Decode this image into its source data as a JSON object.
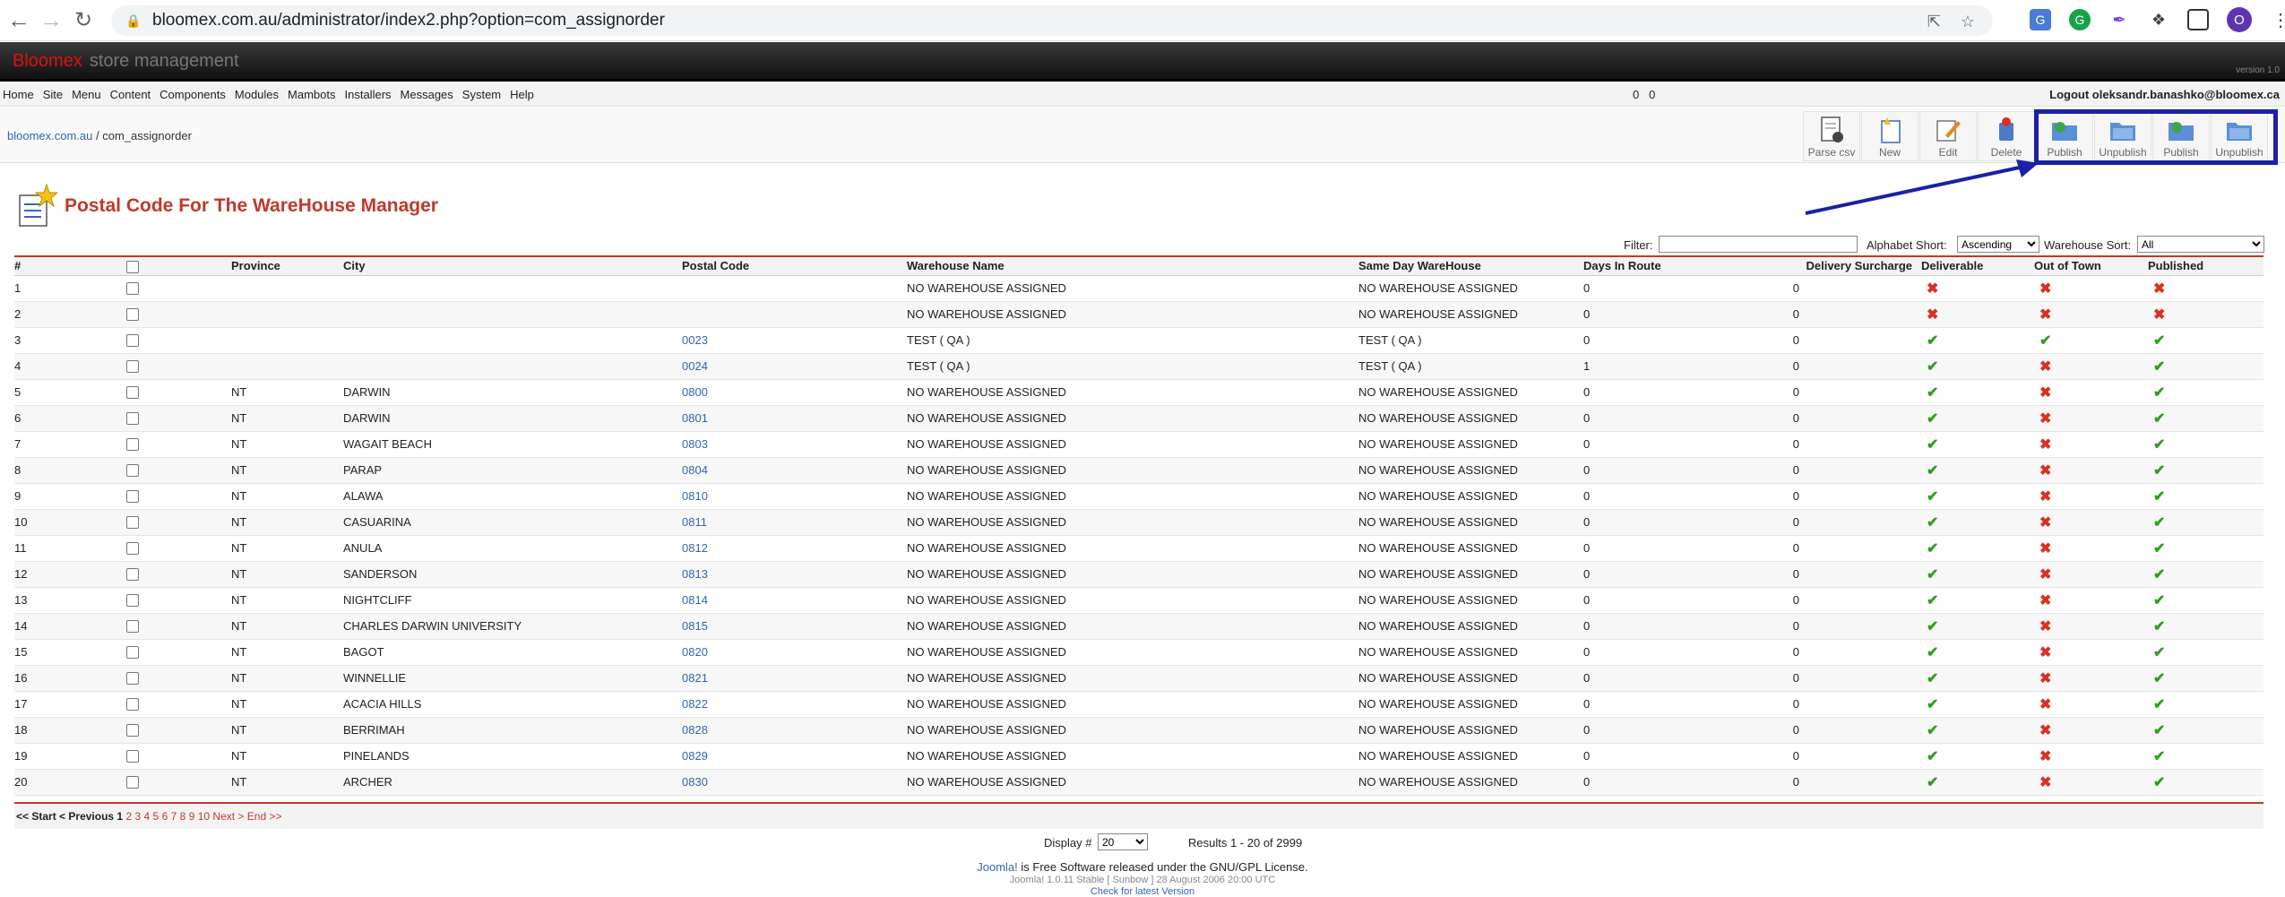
{
  "browser": {
    "url": "bloomex.com.au/administrator/index2.php?option=com_assignorder",
    "profile_initial": "O"
  },
  "header": {
    "brand": "Bloomex",
    "subtitle": "store management",
    "version": "version 1.0"
  },
  "menu": {
    "items": [
      "Home",
      "Site",
      "Menu",
      "Content",
      "Components",
      "Modules",
      "Mambots",
      "Installers",
      "Messages",
      "System",
      "Help"
    ],
    "counter_a": "0",
    "counter_b": "0",
    "logout": "Logout oleksandr.banashko@bloomex.ca"
  },
  "pathway": {
    "site": "bloomex.com.au",
    "separator": " / ",
    "component": "com_assignorder"
  },
  "toolbar": {
    "buttons": [
      {
        "label": "Parse csv"
      },
      {
        "label": "New"
      },
      {
        "label": "Edit"
      },
      {
        "label": "Delete"
      },
      {
        "label": "Publish"
      },
      {
        "label": "Unpublish"
      },
      {
        "label": "Publish"
      },
      {
        "label": "Unpublish"
      }
    ]
  },
  "page": {
    "title": "Postal Code For The WareHouse Manager"
  },
  "filter": {
    "label": "Filter:",
    "value": "",
    "sort_label": "Alphabet Short:",
    "sort_value": "Ascending",
    "warehouse_label": "Warehouse Sort:",
    "warehouse_value": "All"
  },
  "table": {
    "headers": {
      "num": "#",
      "province": "Province",
      "city": "City",
      "postal": "Postal Code",
      "warehouse": "Warehouse Name",
      "sameday": "Same Day WareHouse",
      "days": "Days In Route",
      "surcharge": "Delivery Surcharge",
      "deliverable": "Deliverable",
      "outoftown": "Out of Town",
      "published": "Published"
    },
    "rows": [
      {
        "num": "1",
        "province": "",
        "city": "",
        "postal": "",
        "warehouse": "NO WAREHOUSE ASSIGNED",
        "sameday": "NO WAREHOUSE ASSIGNED",
        "days": "0",
        "surcharge": "0",
        "deliverable": "no",
        "outoftown": "no",
        "published": "no"
      },
      {
        "num": "2",
        "province": "",
        "city": "",
        "postal": "",
        "warehouse": "NO WAREHOUSE ASSIGNED",
        "sameday": "NO WAREHOUSE ASSIGNED",
        "days": "0",
        "surcharge": "0",
        "deliverable": "no",
        "outoftown": "no",
        "published": "no"
      },
      {
        "num": "3",
        "province": "",
        "city": "",
        "postal": "0023",
        "warehouse": "TEST ( QA )",
        "sameday": "TEST ( QA )",
        "days": "0",
        "surcharge": "0",
        "deliverable": "yes",
        "outoftown": "yes",
        "published": "yes"
      },
      {
        "num": "4",
        "province": "",
        "city": "",
        "postal": "0024",
        "warehouse": "TEST ( QA )",
        "sameday": "TEST ( QA )",
        "days": "1",
        "surcharge": "0",
        "deliverable": "yes",
        "outoftown": "no",
        "published": "yes"
      },
      {
        "num": "5",
        "province": "NT",
        "city": "DARWIN",
        "postal": "0800",
        "warehouse": "NO WAREHOUSE ASSIGNED",
        "sameday": "NO WAREHOUSE ASSIGNED",
        "days": "0",
        "surcharge": "0",
        "deliverable": "yes",
        "outoftown": "no",
        "published": "yes"
      },
      {
        "num": "6",
        "province": "NT",
        "city": "DARWIN",
        "postal": "0801",
        "warehouse": "NO WAREHOUSE ASSIGNED",
        "sameday": "NO WAREHOUSE ASSIGNED",
        "days": "0",
        "surcharge": "0",
        "deliverable": "yes",
        "outoftown": "no",
        "published": "yes"
      },
      {
        "num": "7",
        "province": "NT",
        "city": "WAGAIT BEACH",
        "postal": "0803",
        "warehouse": "NO WAREHOUSE ASSIGNED",
        "sameday": "NO WAREHOUSE ASSIGNED",
        "days": "0",
        "surcharge": "0",
        "deliverable": "yes",
        "outoftown": "no",
        "published": "yes"
      },
      {
        "num": "8",
        "province": "NT",
        "city": "PARAP",
        "postal": "0804",
        "warehouse": "NO WAREHOUSE ASSIGNED",
        "sameday": "NO WAREHOUSE ASSIGNED",
        "days": "0",
        "surcharge": "0",
        "deliverable": "yes",
        "outoftown": "no",
        "published": "yes"
      },
      {
        "num": "9",
        "province": "NT",
        "city": "ALAWA",
        "postal": "0810",
        "warehouse": "NO WAREHOUSE ASSIGNED",
        "sameday": "NO WAREHOUSE ASSIGNED",
        "days": "0",
        "surcharge": "0",
        "deliverable": "yes",
        "outoftown": "no",
        "published": "yes"
      },
      {
        "num": "10",
        "province": "NT",
        "city": "CASUARINA",
        "postal": "0811",
        "warehouse": "NO WAREHOUSE ASSIGNED",
        "sameday": "NO WAREHOUSE ASSIGNED",
        "days": "0",
        "surcharge": "0",
        "deliverable": "yes",
        "outoftown": "no",
        "published": "yes"
      },
      {
        "num": "11",
        "province": "NT",
        "city": "ANULA",
        "postal": "0812",
        "warehouse": "NO WAREHOUSE ASSIGNED",
        "sameday": "NO WAREHOUSE ASSIGNED",
        "days": "0",
        "surcharge": "0",
        "deliverable": "yes",
        "outoftown": "no",
        "published": "yes"
      },
      {
        "num": "12",
        "province": "NT",
        "city": "SANDERSON",
        "postal": "0813",
        "warehouse": "NO WAREHOUSE ASSIGNED",
        "sameday": "NO WAREHOUSE ASSIGNED",
        "days": "0",
        "surcharge": "0",
        "deliverable": "yes",
        "outoftown": "no",
        "published": "yes"
      },
      {
        "num": "13",
        "province": "NT",
        "city": "NIGHTCLIFF",
        "postal": "0814",
        "warehouse": "NO WAREHOUSE ASSIGNED",
        "sameday": "NO WAREHOUSE ASSIGNED",
        "days": "0",
        "surcharge": "0",
        "deliverable": "yes",
        "outoftown": "no",
        "published": "yes"
      },
      {
        "num": "14",
        "province": "NT",
        "city": "CHARLES DARWIN UNIVERSITY",
        "postal": "0815",
        "warehouse": "NO WAREHOUSE ASSIGNED",
        "sameday": "NO WAREHOUSE ASSIGNED",
        "days": "0",
        "surcharge": "0",
        "deliverable": "yes",
        "outoftown": "no",
        "published": "yes"
      },
      {
        "num": "15",
        "province": "NT",
        "city": "BAGOT",
        "postal": "0820",
        "warehouse": "NO WAREHOUSE ASSIGNED",
        "sameday": "NO WAREHOUSE ASSIGNED",
        "days": "0",
        "surcharge": "0",
        "deliverable": "yes",
        "outoftown": "no",
        "published": "yes"
      },
      {
        "num": "16",
        "province": "NT",
        "city": "WINNELLIE",
        "postal": "0821",
        "warehouse": "NO WAREHOUSE ASSIGNED",
        "sameday": "NO WAREHOUSE ASSIGNED",
        "days": "0",
        "surcharge": "0",
        "deliverable": "yes",
        "outoftown": "no",
        "published": "yes"
      },
      {
        "num": "17",
        "province": "NT",
        "city": "ACACIA HILLS",
        "postal": "0822",
        "warehouse": "NO WAREHOUSE ASSIGNED",
        "sameday": "NO WAREHOUSE ASSIGNED",
        "days": "0",
        "surcharge": "0",
        "deliverable": "yes",
        "outoftown": "no",
        "published": "yes"
      },
      {
        "num": "18",
        "province": "NT",
        "city": "BERRIMAH",
        "postal": "0828",
        "warehouse": "NO WAREHOUSE ASSIGNED",
        "sameday": "NO WAREHOUSE ASSIGNED",
        "days": "0",
        "surcharge": "0",
        "deliverable": "yes",
        "outoftown": "no",
        "published": "yes"
      },
      {
        "num": "19",
        "province": "NT",
        "city": "PINELANDS",
        "postal": "0829",
        "warehouse": "NO WAREHOUSE ASSIGNED",
        "sameday": "NO WAREHOUSE ASSIGNED",
        "days": "0",
        "surcharge": "0",
        "deliverable": "yes",
        "outoftown": "no",
        "published": "yes"
      },
      {
        "num": "20",
        "province": "NT",
        "city": "ARCHER",
        "postal": "0830",
        "warehouse": "NO WAREHOUSE ASSIGNED",
        "sameday": "NO WAREHOUSE ASSIGNED",
        "days": "0",
        "surcharge": "0",
        "deliverable": "yes",
        "outoftown": "no",
        "published": "yes"
      }
    ]
  },
  "pagination": {
    "start": "<< Start",
    "previous": "< Previous",
    "current": "1",
    "pages": [
      "2",
      "3",
      "4",
      "5",
      "6",
      "7",
      "8",
      "9",
      "10"
    ],
    "next": "Next >",
    "end": "End >>"
  },
  "display": {
    "label": "Display #",
    "value": "20",
    "results": "Results 1 - 20 of 2999"
  },
  "footer": {
    "joomla_link": "Joomla!",
    "license": " is Free Software released under the GNU/GPL License.",
    "version_line": "Joomla! 1.0.11 Stable [ Sunbow ] 28 August 2006 20:00 UTC",
    "check": "Check for latest Version"
  },
  "colors": {
    "title_red": "#c0392b",
    "highlight_blue": "#1a21a6",
    "check_green": "#2e9e1e",
    "cross_red": "#d8321f"
  }
}
